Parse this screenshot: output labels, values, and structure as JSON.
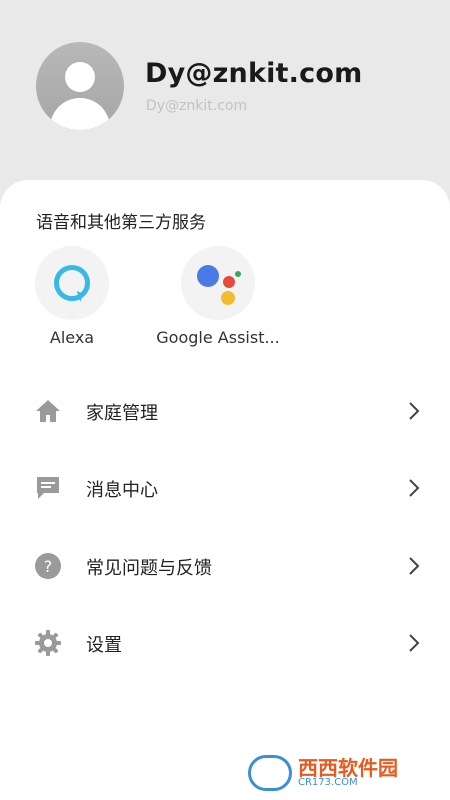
{
  "profile": {
    "name": "Dy@znkit.com",
    "email": "Dy@znkit.com"
  },
  "services": {
    "title": "语音和其他第三方服务",
    "items": [
      {
        "label": "Alexa",
        "icon": "alexa-icon"
      },
      {
        "label": "Google Assist...",
        "icon": "google-assistant-icon"
      }
    ]
  },
  "menu": [
    {
      "label": "家庭管理",
      "icon": "home-icon"
    },
    {
      "label": "消息中心",
      "icon": "message-icon"
    },
    {
      "label": "常见问题与反馈",
      "icon": "help-icon"
    },
    {
      "label": "设置",
      "icon": "gear-icon"
    }
  ],
  "watermark": {
    "text": "西西软件园",
    "sub": "CR173.COM"
  },
  "colors": {
    "alexa": "#36b9e6",
    "ga_blue": "#4a7ae6",
    "ga_red": "#e54b3c",
    "ga_yellow": "#f4bb2f",
    "ga_green": "#3aa856",
    "icon_gray": "#9a9a9a"
  }
}
